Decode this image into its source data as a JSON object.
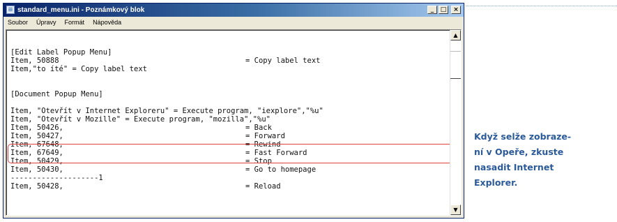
{
  "window": {
    "title": "standard_menu.ini - Poznámkový blok",
    "buttons": {
      "minimize": "_",
      "maximize": "□",
      "close": "×"
    }
  },
  "menu": [
    "Soubor",
    "Úpravy",
    "Formát",
    "Nápověda"
  ],
  "lines": [
    {
      "left": "[Edit Label Popup Menu]",
      "right": ""
    },
    {
      "left": "Item, 50888",
      "right": "= Copy label text"
    },
    {
      "left": "Item,\"to íté\" = Copy label text",
      "right": ""
    },
    {
      "left": "",
      "right": ""
    },
    {
      "left": "",
      "right": ""
    },
    {
      "left": "[Document Popup Menu]",
      "right": ""
    },
    {
      "left": "",
      "right": ""
    },
    {
      "left": "Item, \"Otevřít v Internet Exploreru\" = Execute program, \"iexplore\",\"%u\"",
      "right": ""
    },
    {
      "left": "Item, \"Otevřít v Mozille\" = Execute program, \"mozilla\",\"%u\"",
      "right": ""
    },
    {
      "left": "Item, 50426,",
      "right": "= Back"
    },
    {
      "left": "Item, 50427,",
      "right": "= Forward"
    },
    {
      "left": "Item, 67648,",
      "right": "= Rewind"
    },
    {
      "left": "Item, 67649,",
      "right": "= Fast Forward"
    },
    {
      "left": "Item, 50429,",
      "right": "= Stop"
    },
    {
      "left": "Item, 50430,",
      "right": "= Go to homepage"
    },
    {
      "left": "--------------------1",
      "right": ""
    },
    {
      "left": "Item, 50428,",
      "right": "= Reload"
    }
  ],
  "caption": "Když selže zobraze-\nní v Opeře, zkuste\nnasadit Internet\nExplorer.",
  "colors": {
    "highlight": "#e04040",
    "caption": "#2a5a9a",
    "titlebar": "#0a246a"
  }
}
